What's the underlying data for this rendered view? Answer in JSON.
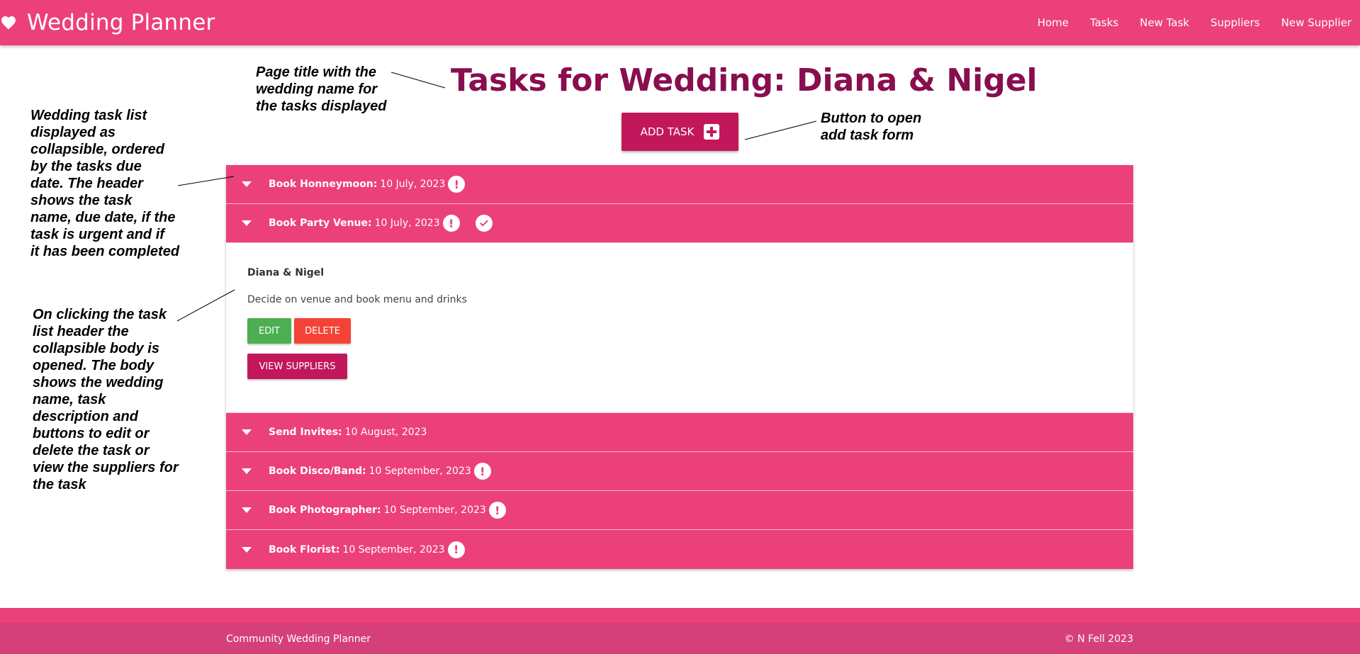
{
  "navbar": {
    "brand": "Wedding Planner",
    "brand_icon": "heart-icon",
    "links": [
      "Home",
      "Tasks",
      "New Task",
      "Suppliers",
      "New Supplier"
    ]
  },
  "page": {
    "title": "Tasks for Wedding: Diana & Nigel",
    "add_task_label": "ADD TASK",
    "add_task_icon": "plus-box-icon"
  },
  "tasks": [
    {
      "name": "Book Honneymoon:",
      "date": "10 July, 2023",
      "urgent": true,
      "completed": false
    },
    {
      "name": "Book Party Venue:",
      "date": "10 July, 2023",
      "urgent": true,
      "completed": true,
      "expanded": true
    },
    {
      "name": "Send Invites:",
      "date": "10 August, 2023",
      "urgent": false,
      "completed": false
    },
    {
      "name": "Book Disco/Band:",
      "date": "10 September, 2023",
      "urgent": true,
      "completed": false
    },
    {
      "name": "Book Photographer:",
      "date": "10 September, 2023",
      "urgent": true,
      "completed": false
    },
    {
      "name": "Book Florist:",
      "date": "10 September, 2023",
      "urgent": true,
      "completed": false
    }
  ],
  "expanded_body": {
    "wedding_name": "Diana & Nigel",
    "description": "Decide on venue and book menu and drinks",
    "edit_label": "EDIT",
    "delete_label": "DELETE",
    "view_suppliers_label": "VIEW SUPPLIERS"
  },
  "annotations": {
    "title_note": [
      "Page title with the",
      "wedding name for",
      "the tasks displayed"
    ],
    "button_note": [
      "Button to open",
      "add task form"
    ],
    "list_note": [
      "Wedding task list",
      "displayed as",
      "collapsible, ordered",
      "by the tasks due",
      "date. The header",
      "shows the task",
      "name, due date, if the",
      "task is urgent and if",
      "it has been completed"
    ],
    "body_note": [
      "On clicking the task",
      "list header the",
      "collapsible body is",
      "opened. The body",
      "shows the wedding",
      "name, task",
      "description and",
      "buttons to edit or",
      "delete the task or",
      "view the suppliers for",
      "the task"
    ]
  },
  "footer": {
    "left": "Community Wedding Planner",
    "right": "© N Fell 2023"
  },
  "colors": {
    "primary": "#ec407a",
    "accent": "#c2185b",
    "title": "#880e4f",
    "edit": "#4caf50",
    "delete": "#f44336"
  }
}
